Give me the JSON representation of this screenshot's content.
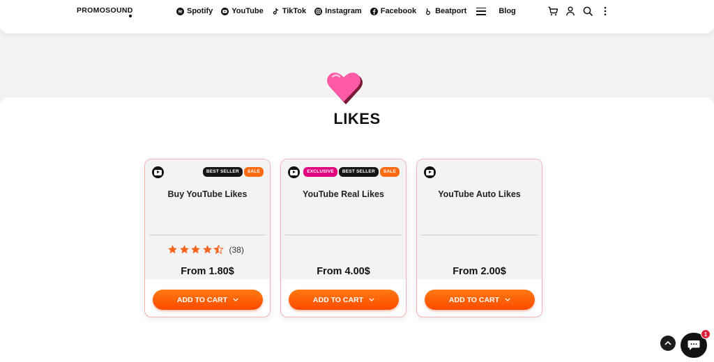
{
  "header": {
    "logo": "PROMOSOUND",
    "nav": [
      {
        "label": "Spotify",
        "icon": "spotify-icon"
      },
      {
        "label": "YouTube",
        "icon": "youtube-icon"
      },
      {
        "label": "TikTok",
        "icon": "tiktok-icon"
      },
      {
        "label": "Instagram",
        "icon": "instagram-icon"
      },
      {
        "label": "Facebook",
        "icon": "facebook-icon"
      },
      {
        "label": "Beatport",
        "icon": "beatport-icon"
      }
    ],
    "blog_label": "Blog",
    "right_icons": [
      "cart-icon",
      "user-icon",
      "search-icon",
      "more-vertical-icon"
    ]
  },
  "page": {
    "title": "LIKES",
    "hero_icon": "heart-icon"
  },
  "products": [
    {
      "name": "Buy YouTube Likes",
      "platform_icon": "youtube-icon",
      "tags": [
        {
          "label": "BEST SELLER",
          "kind": "best"
        },
        {
          "label": "SALE",
          "kind": "sale"
        }
      ],
      "rating": 4.5,
      "rating_count": "(38)",
      "price": "From 1.80$",
      "button_label": "ADD TO CART"
    },
    {
      "name": "YouTube Real Likes",
      "platform_icon": "youtube-icon",
      "tags": [
        {
          "label": "EXCLUSIVE",
          "kind": "excl"
        },
        {
          "label": "BEST SELLER",
          "kind": "best"
        },
        {
          "label": "SALE",
          "kind": "sale"
        }
      ],
      "price": "From 4.00$",
      "button_label": "ADD TO CART"
    },
    {
      "name": "YouTube Auto Likes",
      "platform_icon": "youtube-icon",
      "tags": [],
      "price": "From 2.00$",
      "button_label": "ADD TO CART"
    }
  ],
  "chat": {
    "badge_count": "1"
  },
  "colors": {
    "accent_orange": "#ff5a0a",
    "exclusive_pink": "#e3007d",
    "star_orange": "#f26522",
    "dark": "#111111"
  }
}
